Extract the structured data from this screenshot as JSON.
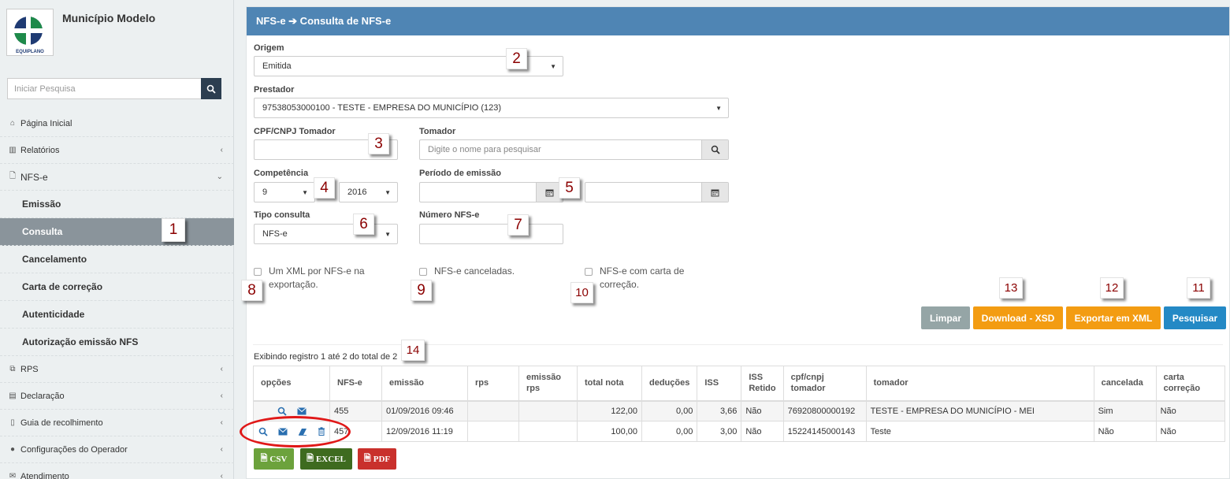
{
  "sidebar": {
    "brand_title": "Município Modelo",
    "logo_text": "EQUIPLANO",
    "search_placeholder": "Iniciar Pesquisa",
    "items": [
      {
        "label": "Página Inicial",
        "icon": "home-icon"
      },
      {
        "label": "Relatórios",
        "icon": "bar-chart-icon"
      },
      {
        "label": "NFS-e",
        "icon": "file-icon"
      },
      {
        "label": "RPS",
        "icon": "copy-icon"
      },
      {
        "label": "Declaração",
        "icon": "file-text-icon"
      },
      {
        "label": "Guia de recolhimento",
        "icon": "barcode-icon"
      },
      {
        "label": "Configurações do Operador",
        "icon": "user-icon"
      },
      {
        "label": "Atendimento",
        "icon": "envelope-icon"
      }
    ],
    "sub_items": [
      "Emissão",
      "Consulta",
      "Cancelamento",
      "Carta de correção",
      "Autenticidade",
      "Autorização emissão NFS"
    ],
    "active_sub": "Consulta"
  },
  "header": {
    "title": "NFS-e ➔ Consulta de NFS-e"
  },
  "form": {
    "origem_label": "Origem",
    "origem_value": "Emitida",
    "prestador_label": "Prestador",
    "prestador_value": "97538053000100 - TESTE - EMPRESA DO MUNICÍPIO (123)",
    "cpf_label": "CPF/CNPJ Tomador",
    "cpf_value": "",
    "tomador_label": "Tomador",
    "tomador_placeholder": "Digite o nome para pesquisar",
    "competencia_label": "Competência",
    "competencia_month": "9",
    "competencia_year": "2016",
    "periodo_label": "Período de emissão",
    "tipo_label": "Tipo consulta",
    "tipo_value": "NFS-e",
    "numero_label": "Número NFS-e",
    "chk_xml_line1": "Um XML por NFS-e na",
    "chk_xml_line2": "exportação.",
    "chk_canceladas": "NFS-e canceladas.",
    "chk_carta_line1": "NFS-e com carta de",
    "chk_carta_line2": "correção."
  },
  "buttons": {
    "limpar": "Limpar",
    "download_xsd": "Download - XSD",
    "exportar_xml": "Exportar em XML",
    "pesquisar": "Pesquisar"
  },
  "results": {
    "info": "Exibindo registro 1 até 2 do total de 2",
    "columns": [
      "opções",
      "NFS-e",
      "emissão",
      "rps",
      "emissão rps",
      "total nota",
      "deduções",
      "ISS",
      "ISS Retido",
      "cpf/cnpj tomador",
      "tomador",
      "cancelada",
      "carta correção"
    ],
    "rows": [
      {
        "nfse": "455",
        "emissao": "01/09/2016 09:46",
        "rps": "",
        "emissao_rps": "",
        "total": "122,00",
        "deducoes": "0,00",
        "iss": "3,66",
        "iss_retido": "Não",
        "cpf": "76920800000192",
        "tomador": "TESTE - EMPRESA DO MUNICÍPIO - MEI",
        "cancelada": "Sim",
        "carta": "Não"
      },
      {
        "nfse": "457",
        "emissao": "12/09/2016 11:19",
        "rps": "",
        "emissao_rps": "",
        "total": "100,00",
        "deducoes": "0,00",
        "iss": "3,00",
        "iss_retido": "Não",
        "cpf": "15224145000143",
        "tomador": "Teste",
        "cancelada": "Não",
        "carta": "Não"
      }
    ]
  },
  "export": {
    "csv": "CSV",
    "excel": "EXCEL",
    "pdf": "PDF"
  },
  "annotations": [
    "1",
    "2",
    "3",
    "4",
    "5",
    "6",
    "7",
    "8",
    "9",
    "10",
    "11",
    "12",
    "13",
    "14"
  ],
  "colors": {
    "header": "#4f85b4",
    "sidebar_active": "#8a949b",
    "orange": "#f39c12",
    "blue": "#2489c5",
    "grey": "#95a5a6",
    "annotation_ring": "#e01818"
  }
}
